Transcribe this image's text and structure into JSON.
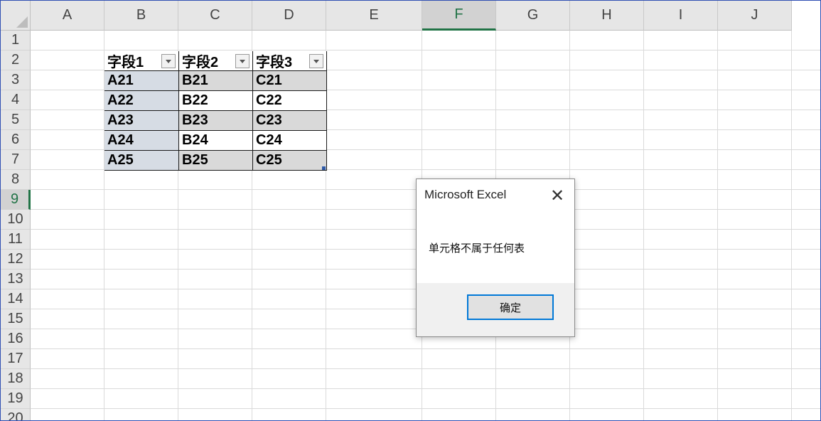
{
  "sheet": {
    "columns": [
      "A",
      "B",
      "C",
      "D",
      "E",
      "F",
      "G",
      "H",
      "I",
      "J"
    ],
    "active_column": "F",
    "rows": [
      "1",
      "2",
      "3",
      "4",
      "5",
      "6",
      "7",
      "8",
      "9",
      "10",
      "11",
      "12",
      "13",
      "14",
      "15",
      "16",
      "17",
      "18",
      "19",
      "20"
    ],
    "active_row": "9"
  },
  "table": {
    "headers": [
      "字段1",
      "字段2",
      "字段3"
    ],
    "rows": [
      [
        "A21",
        "B21",
        "C21"
      ],
      [
        "A22",
        "B22",
        "C22"
      ],
      [
        "A23",
        "B23",
        "C23"
      ],
      [
        "A24",
        "B24",
        "C24"
      ],
      [
        "A25",
        "B25",
        "C25"
      ]
    ]
  },
  "dialog": {
    "title": "Microsoft Excel",
    "close_glyph": "✕",
    "message": "单元格不属于任何表",
    "ok_label": "确定"
  }
}
